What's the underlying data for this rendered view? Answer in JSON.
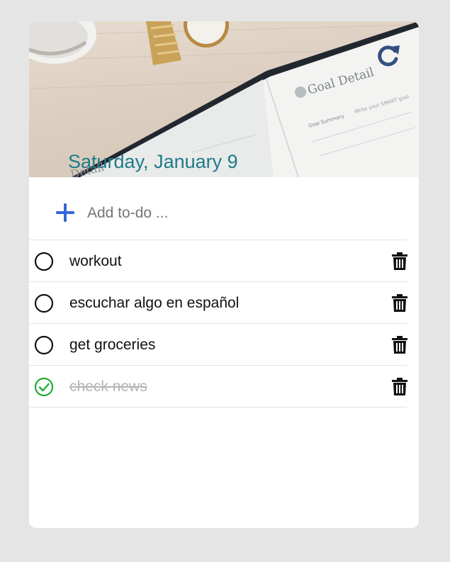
{
  "header": {
    "date": "Saturday, January 9",
    "refresh_icon": "refresh-icon",
    "background": "desk photo with wristwatch and goal planner notebook",
    "decor": {
      "notebook_title": "Goal Detail",
      "notebook_summary": "Goal Summary",
      "notebook_summary_hint": "Write your SMART goal",
      "notebook_fragment": "Detail"
    }
  },
  "add_todo": {
    "icon": "plus-icon",
    "placeholder": "Add to-do ..."
  },
  "todos": [
    {
      "text": "workout",
      "done": false
    },
    {
      "text": "escuchar algo en español",
      "done": false
    },
    {
      "text": "get groceries",
      "done": false
    },
    {
      "text": "check news",
      "done": true
    }
  ],
  "colors": {
    "page_bg": "#e5e5e5",
    "date_text": "#1f7b8a",
    "refresh_icon": "#334f80",
    "plus_icon": "#3366dd",
    "done_check": "#22aa33",
    "trash": "#111111"
  }
}
